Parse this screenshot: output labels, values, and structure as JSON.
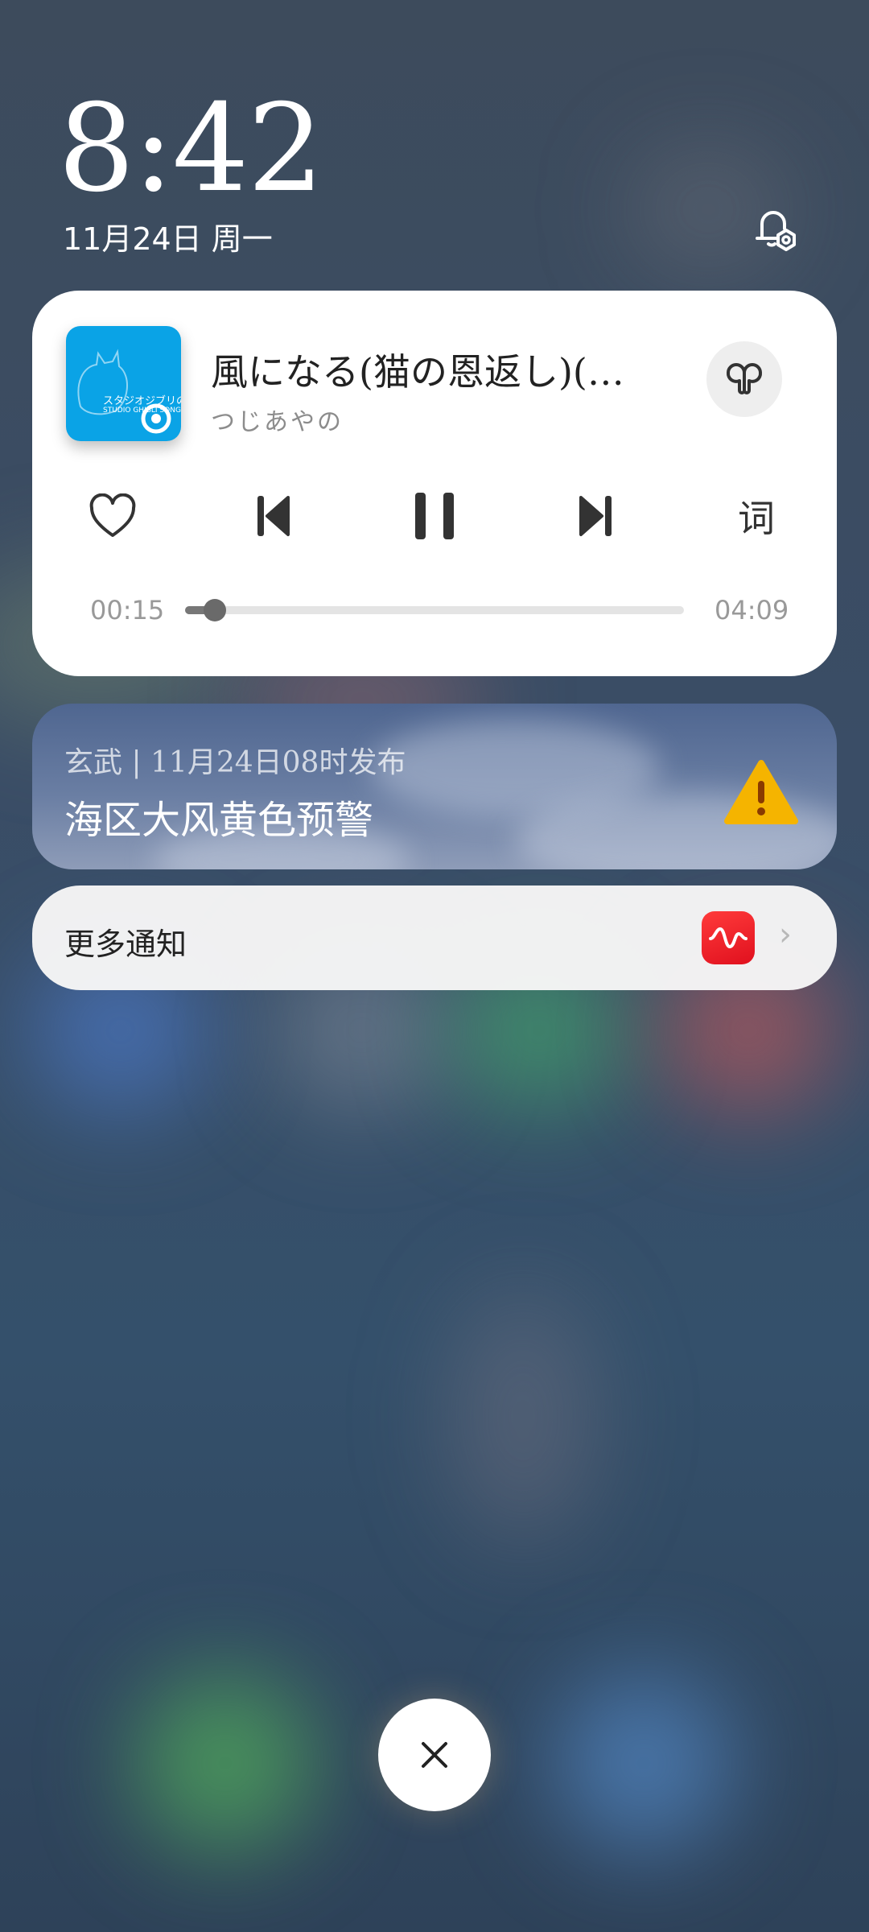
{
  "lockscreen": {
    "time": "8:42",
    "date": "11月24日 周一"
  },
  "media": {
    "album_art_text": "スタジオジブリの歌",
    "album_art_subtext": "STUDIO GHIBLI SONGS",
    "title": "風になる(猫の恩返し)(…",
    "artist": "つじあやの",
    "lyrics_label": "词",
    "time_current": "00:15",
    "time_total": "04:09",
    "progress": 0.06,
    "accent_color": "#0aa3e6"
  },
  "weather_alert": {
    "meta": "玄武 | 11月24日08时发布",
    "title": "海区大风黄色预警",
    "level_color": "#f5b400"
  },
  "more_notifications": {
    "label": "更多通知",
    "app_icon_color": "#f01a24"
  },
  "icons": {
    "bell_settings": "bell-settings-icon",
    "audio_output": "earbuds-icon",
    "like": "heart-icon",
    "prev": "skip-previous-icon",
    "pause": "pause-icon",
    "next": "skip-next-icon",
    "warning": "warning-triangle-icon",
    "close": "close-icon"
  }
}
